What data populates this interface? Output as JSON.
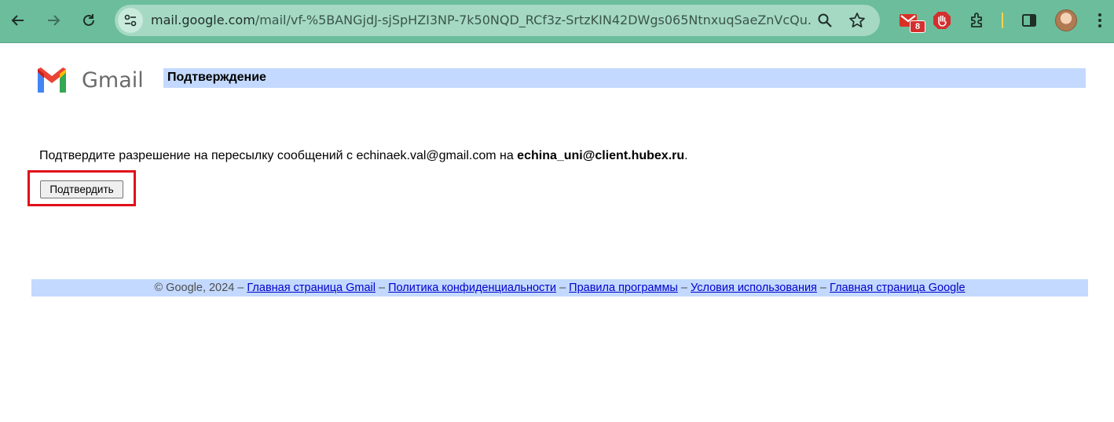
{
  "browser": {
    "url_host": "mail.google.com",
    "url_path": "/mail/vf-%5BANGjdJ-sjSpHZI3NP-7k50NQD_RCf3z-SrtzKIN42DWgs065NtnxuqSaeZnVcQu...",
    "extension_badge": "8",
    "icons": [
      "back-icon",
      "forward-icon",
      "reload-icon",
      "site-info-icon",
      "zoom-icon",
      "star-icon",
      "gmail-extension-icon",
      "adblock-icon",
      "extensions-icon",
      "side-panel-icon",
      "avatar",
      "menu-icon"
    ]
  },
  "page": {
    "logo_text": "Gmail",
    "title": "Подтверждение",
    "message_prefix": "Подтвердите разрешение на пересылку сообщений с echinaek.val@gmail.com на ",
    "message_target": "echina_uni@client.hubex.ru",
    "message_suffix": ".",
    "confirm_button": "Подтвердить"
  },
  "footer": {
    "copyright": "© Google, 2024",
    "sep": " – ",
    "links": [
      "Главная страница Gmail",
      "Политика конфиденциальности",
      "Правила программы",
      "Условия использования",
      "Главная страница Google"
    ]
  },
  "colors": {
    "toolbar": "#6bbd9c",
    "title_bar": "#c3d9ff",
    "highlight": "#e0101a",
    "link": "#0000cc"
  }
}
